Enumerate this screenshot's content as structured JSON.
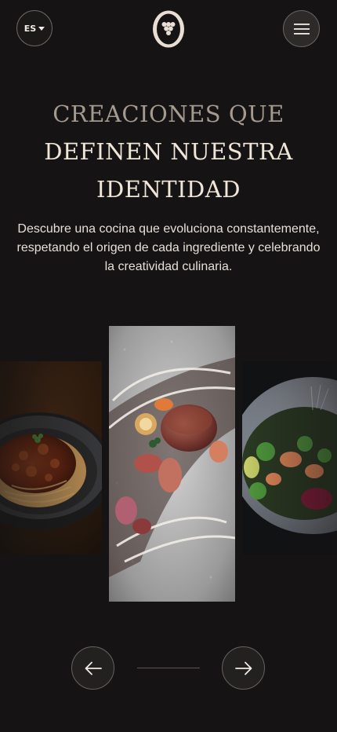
{
  "header": {
    "language_label": "ES",
    "language_icon": "caret-down-icon",
    "logo_icon": "grape-cluster-logo",
    "menu_icon": "hamburger-menu-icon"
  },
  "hero": {
    "title_line1": "CREACIONES QUE",
    "title_line2": "DEFINEN NUESTRA",
    "title_line3": "IDENTIDAD",
    "subtitle": "Descubre una cocina que evoluciona constantemente, respetando el origen de cada ingrediente y celebrando la creatividad culinaria."
  },
  "carousel": {
    "slides": [
      {
        "subject": "pasta-bolognese-dish",
        "position": "previous"
      },
      {
        "subject": "plated-meat-medallion-dish",
        "position": "active"
      },
      {
        "subject": "salmon-poke-bowl",
        "position": "next"
      }
    ],
    "prev_icon": "arrow-left-icon",
    "next_icon": "arrow-right-icon"
  },
  "colors": {
    "background": "#151313",
    "title_muted": "#a59a90",
    "title_light": "#efe5d9",
    "button_border": "#6a6562"
  }
}
